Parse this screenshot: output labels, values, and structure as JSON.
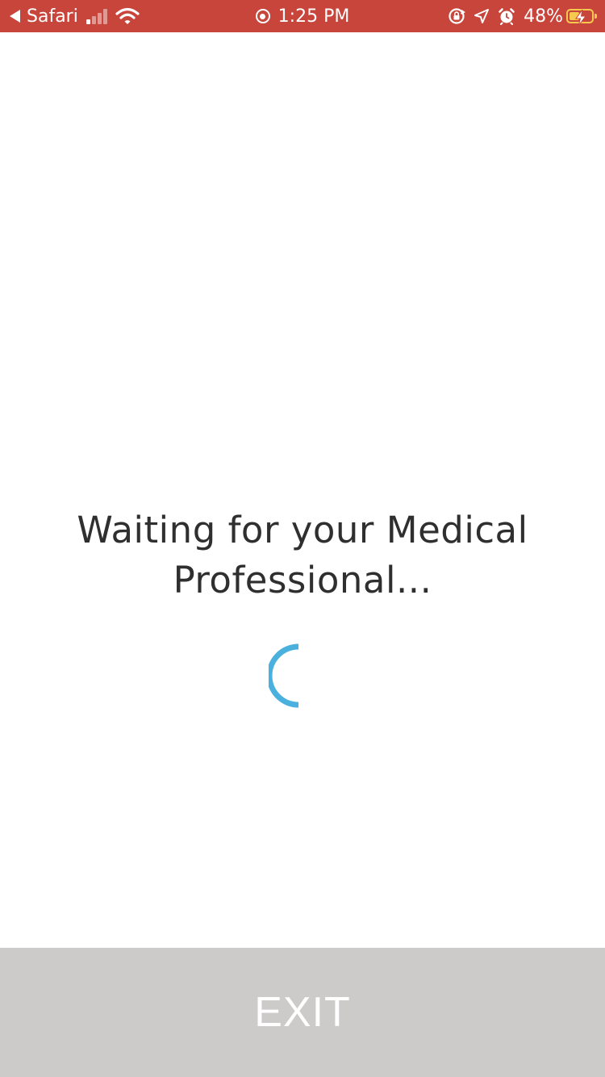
{
  "status_bar": {
    "back_app": "Safari",
    "time": "1:25 PM",
    "battery_percent": "48%",
    "battery_level": 0.48,
    "signal_bars_active": 1,
    "signal_bars_total": 4,
    "background_color": "#c8453c",
    "battery_color": "#f6c94e",
    "icons": {
      "back": "back-caret-icon",
      "signal": "cellular-signal-icon",
      "wifi": "wifi-icon",
      "recording": "screen-recording-icon",
      "rotation_lock": "rotation-lock-icon",
      "location": "location-arrow-icon",
      "alarm": "alarm-clock-icon",
      "battery": "battery-charging-icon"
    }
  },
  "main": {
    "waiting_message": "Waiting for your Medical Professional...",
    "spinner_color": "#4ab0de",
    "text_color": "#2f2f2f"
  },
  "footer": {
    "exit_label": "EXIT",
    "background_color": "#cdcaca",
    "text_color": "#ffffff"
  }
}
